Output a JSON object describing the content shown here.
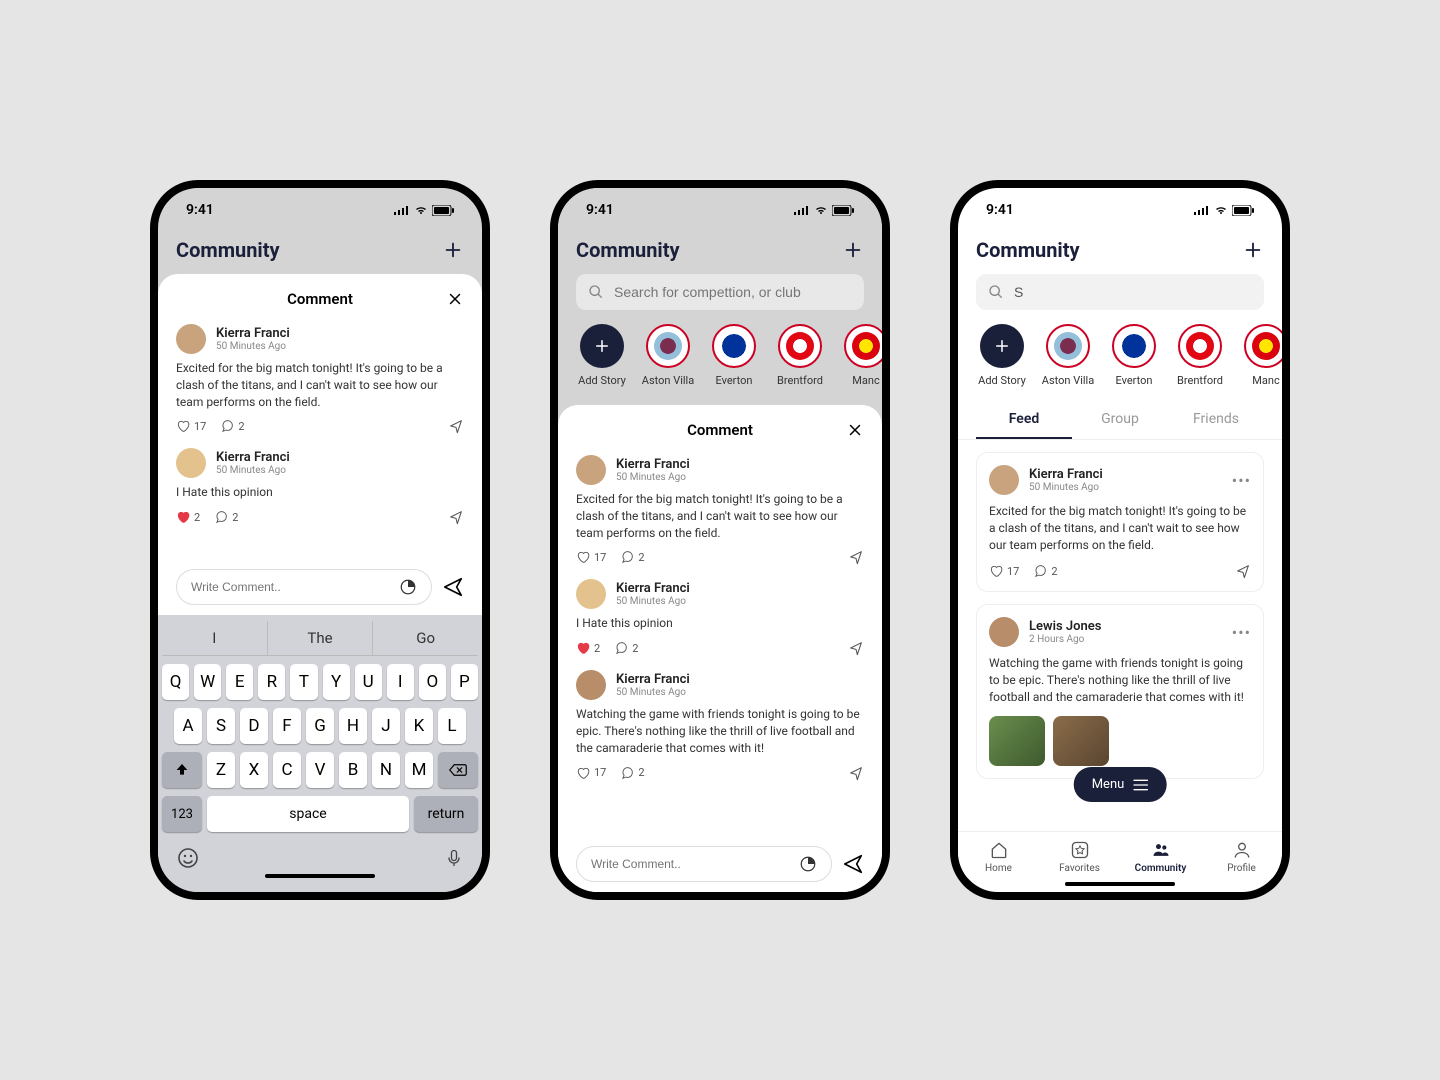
{
  "status": {
    "time": "9:41"
  },
  "header": {
    "title": "Community"
  },
  "search": {
    "placeholder": "Search for compettion, or club",
    "value": "S"
  },
  "stories": [
    {
      "label": "Add Story",
      "type": "add"
    },
    {
      "label": "Aston Villa",
      "type": "villa"
    },
    {
      "label": "Everton",
      "type": "everton"
    },
    {
      "label": "Brentford",
      "type": "brentford"
    },
    {
      "label": "Manc",
      "type": "manu"
    }
  ],
  "sheet": {
    "title": "Comment",
    "comments": [
      {
        "name": "Kierra Franci",
        "time": "50 Minutes Ago",
        "text": "Excited for the big match tonight! It's going to be a clash of the titans, and I can't wait to see how our team performs on the field.",
        "likes": "17",
        "replies": "2",
        "liked": false
      },
      {
        "name": "Kierra Franci",
        "time": "50 Minutes Ago",
        "text": "I Hate this opinion",
        "likes": "2",
        "replies": "2",
        "liked": true
      },
      {
        "name": "Kierra Franci",
        "time": "50 Minutes Ago",
        "text": "Watching the game with friends tonight is going to be epic. There's nothing like the thrill of live football and the camaraderie that comes with it!",
        "likes": "17",
        "replies": "2",
        "liked": false
      }
    ],
    "input_placeholder": "Write Comment.."
  },
  "keyboard": {
    "suggestions": [
      "I",
      "The",
      "Go"
    ],
    "row1": [
      "Q",
      "W",
      "E",
      "R",
      "T",
      "Y",
      "U",
      "I",
      "O",
      "P"
    ],
    "row2": [
      "A",
      "S",
      "D",
      "F",
      "G",
      "H",
      "J",
      "K",
      "L"
    ],
    "row3": [
      "Z",
      "X",
      "C",
      "V",
      "B",
      "N",
      "M"
    ],
    "num": "123",
    "space": "space",
    "return": "return"
  },
  "tabs": [
    "Feed",
    "Group",
    "Friends"
  ],
  "feed": {
    "posts": [
      {
        "name": "Kierra Franci",
        "time": "50 Minutes Ago",
        "text": "Excited for the big match tonight! It's going to be a clash of the titans, and I can't wait to see how our team performs on the field.",
        "likes": "17",
        "replies": "2"
      },
      {
        "name": "Lewis Jones",
        "time": "2 Hours Ago",
        "text": "Watching the game with friends tonight is going to be epic. There's nothing like the thrill of live football and the camaraderie that comes with it!"
      }
    ]
  },
  "menu_fab": "Menu",
  "nav": [
    {
      "label": "Home"
    },
    {
      "label": "Favorites"
    },
    {
      "label": "Community"
    },
    {
      "label": "Profile"
    }
  ]
}
